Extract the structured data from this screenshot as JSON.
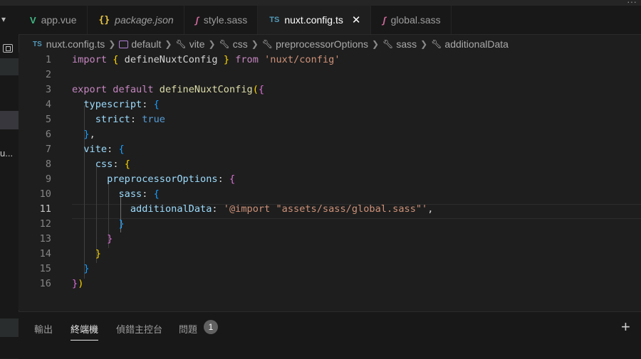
{
  "tabs": [
    {
      "label": "app.vue",
      "icon": "V",
      "icon_name": "vue-icon",
      "italic": false
    },
    {
      "label": "package.json",
      "icon": "{}",
      "icon_name": "json-icon",
      "italic": true
    },
    {
      "label": "style.sass",
      "icon": "ʃ",
      "icon_name": "sass-icon",
      "italic": false
    },
    {
      "label": "nuxt.config.ts",
      "icon": "TS",
      "icon_name": "typescript-icon",
      "italic": false,
      "active": true,
      "close": "✕"
    },
    {
      "label": "global.sass",
      "icon": "ʃ",
      "icon_name": "sass-icon",
      "italic": false
    }
  ],
  "breadcrumb": {
    "file_icon": "TS",
    "file": "nuxt.config.ts",
    "items": [
      "default",
      "vite",
      "css",
      "preprocessorOptions",
      "sass",
      "additionalData"
    ]
  },
  "sidebar_fragment": "u...",
  "editor": {
    "current_line": 11,
    "lines": [
      {
        "n": "1",
        "tokens": [
          [
            "kw2",
            "import"
          ],
          [
            "pun",
            " "
          ],
          [
            "b1",
            "{"
          ],
          [
            "pun",
            " defineNuxtConfig "
          ],
          [
            "b1",
            "}"
          ],
          [
            "pun",
            " "
          ],
          [
            "kw2",
            "from"
          ],
          [
            "pun",
            " "
          ],
          [
            "str",
            "'nuxt/config'"
          ]
        ]
      },
      {
        "n": "2",
        "tokens": []
      },
      {
        "n": "3",
        "tokens": [
          [
            "kw2",
            "export"
          ],
          [
            "pun",
            " "
          ],
          [
            "kw2",
            "default"
          ],
          [
            "pun",
            " "
          ],
          [
            "fn",
            "defineNuxtConfig"
          ],
          [
            "b1",
            "("
          ],
          [
            "b2",
            "{"
          ]
        ]
      },
      {
        "n": "4",
        "tokens": [
          [
            "pun",
            "  "
          ],
          [
            "prop",
            "typescript"
          ],
          [
            "pun",
            ": "
          ],
          [
            "b3",
            "{"
          ]
        ]
      },
      {
        "n": "5",
        "tokens": [
          [
            "pun",
            "    "
          ],
          [
            "prop",
            "strict"
          ],
          [
            "pun",
            ": "
          ],
          [
            "kw",
            "true"
          ]
        ]
      },
      {
        "n": "6",
        "tokens": [
          [
            "pun",
            "  "
          ],
          [
            "b3",
            "}"
          ],
          [
            "pun",
            ","
          ]
        ]
      },
      {
        "n": "7",
        "tokens": [
          [
            "pun",
            "  "
          ],
          [
            "prop",
            "vite"
          ],
          [
            "pun",
            ": "
          ],
          [
            "b3",
            "{"
          ]
        ]
      },
      {
        "n": "8",
        "tokens": [
          [
            "pun",
            "    "
          ],
          [
            "prop",
            "css"
          ],
          [
            "pun",
            ": "
          ],
          [
            "b1",
            "{"
          ]
        ]
      },
      {
        "n": "9",
        "tokens": [
          [
            "pun",
            "      "
          ],
          [
            "prop",
            "preprocessorOptions"
          ],
          [
            "pun",
            ": "
          ],
          [
            "b2",
            "{"
          ]
        ]
      },
      {
        "n": "10",
        "tokens": [
          [
            "pun",
            "        "
          ],
          [
            "prop",
            "sass"
          ],
          [
            "pun",
            ": "
          ],
          [
            "b3",
            "{"
          ]
        ]
      },
      {
        "n": "11",
        "tokens": [
          [
            "pun",
            "          "
          ],
          [
            "prop",
            "additionalData"
          ],
          [
            "pun",
            ": "
          ],
          [
            "str",
            "'@import \"assets/sass/global.sass\"'"
          ],
          [
            "pun",
            ","
          ]
        ]
      },
      {
        "n": "12",
        "tokens": [
          [
            "pun",
            "        "
          ],
          [
            "b3",
            "}"
          ]
        ]
      },
      {
        "n": "13",
        "tokens": [
          [
            "pun",
            "      "
          ],
          [
            "b2",
            "}"
          ]
        ]
      },
      {
        "n": "14",
        "tokens": [
          [
            "pun",
            "    "
          ],
          [
            "b1",
            "}"
          ]
        ]
      },
      {
        "n": "15",
        "tokens": [
          [
            "pun",
            "  "
          ],
          [
            "b3",
            "}"
          ]
        ]
      },
      {
        "n": "16",
        "tokens": [
          [
            "b2",
            "}"
          ],
          [
            "b1",
            ")"
          ]
        ]
      }
    ]
  },
  "panel": {
    "tabs": [
      {
        "label": "輸出",
        "active": false
      },
      {
        "label": "終端機",
        "active": true
      },
      {
        "label": "偵錯主控台",
        "active": false
      },
      {
        "label": "問題",
        "active": false
      }
    ],
    "problems_count": "1",
    "add_label": "+"
  }
}
